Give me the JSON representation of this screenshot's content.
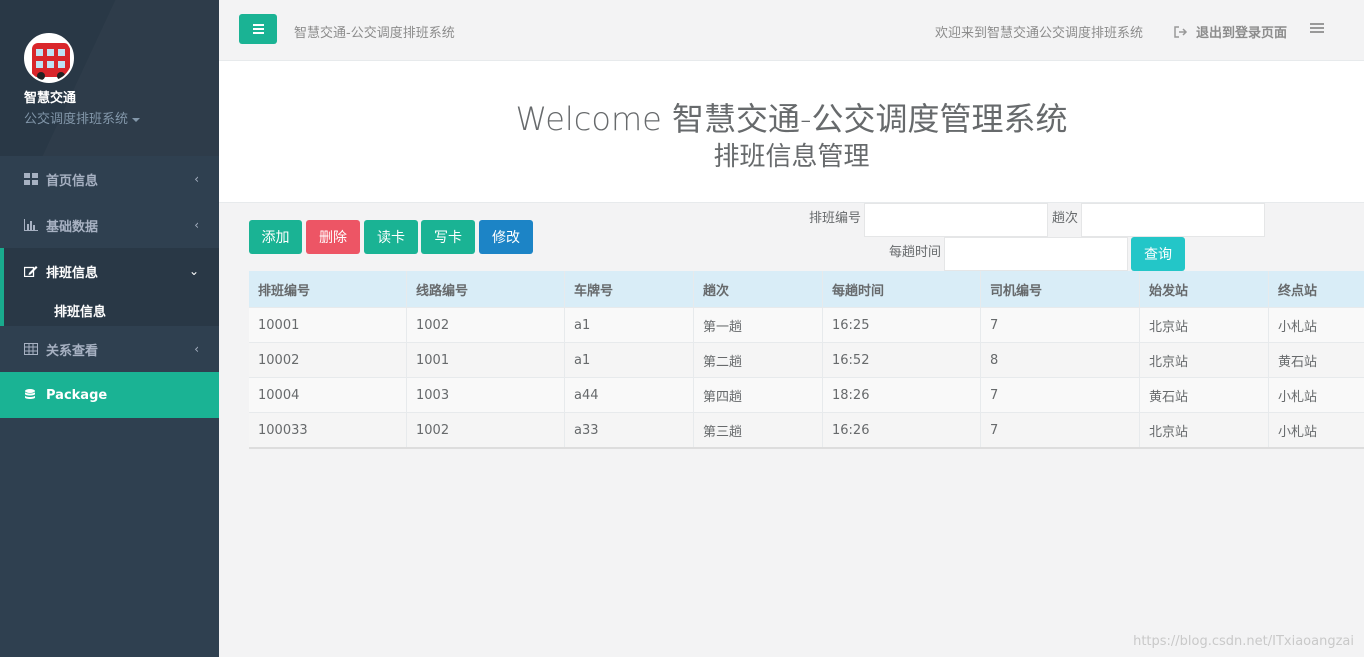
{
  "sidebar": {
    "profile_name": "智慧交通",
    "profile_sub": "公交调度排班系统",
    "items": [
      {
        "label": "首页信息"
      },
      {
        "label": "基础数据"
      },
      {
        "label": "排班信息",
        "sub": "排班信息"
      },
      {
        "label": "关系查看"
      },
      {
        "label": "Package"
      }
    ]
  },
  "topbar": {
    "title": "智慧交通-公交调度排班系统",
    "welcome": "欢迎来到智慧交通公交调度排班系统",
    "logout": "退出到登录页面"
  },
  "header": {
    "welcome": "Welcome 智慧交通-公交调度管理系统",
    "subtitle": "排班信息管理"
  },
  "toolbar": {
    "add": "添加",
    "delete": "删除",
    "read_card": "读卡",
    "write_card": "写卡",
    "edit": "修改"
  },
  "filters": {
    "schedule_id_label": "排班编号",
    "trip_label": "趟次",
    "time_label": "每趟时间",
    "query": "查询"
  },
  "table": {
    "columns": [
      "排班编号",
      "线路编号",
      "车牌号",
      "趟次",
      "每趟时间",
      "司机编号",
      "始发站",
      "终点站"
    ],
    "rows": [
      [
        "10001",
        "1002",
        "a1",
        "第一趟",
        "16:25",
        "7",
        "北京站",
        "小札站"
      ],
      [
        "10002",
        "1001",
        "a1",
        "第二趟",
        "16:52",
        "8",
        "北京站",
        "黄石站"
      ],
      [
        "10004",
        "1003",
        "a44",
        "第四趟",
        "18:26",
        "7",
        "黄石站",
        "小札站"
      ],
      [
        "100033",
        "1002",
        "a33",
        "第三趟",
        "16:26",
        "7",
        "北京站",
        "小札站"
      ]
    ]
  },
  "watermark": "https://blog.csdn.net/ITxiaoangzai",
  "colors": {
    "sidebar": "#2f4050",
    "primary": "#1ab394",
    "danger": "#ed5565",
    "info": "#1c84c6",
    "query": "#23c6c8",
    "table_header": "#d9edf7"
  }
}
